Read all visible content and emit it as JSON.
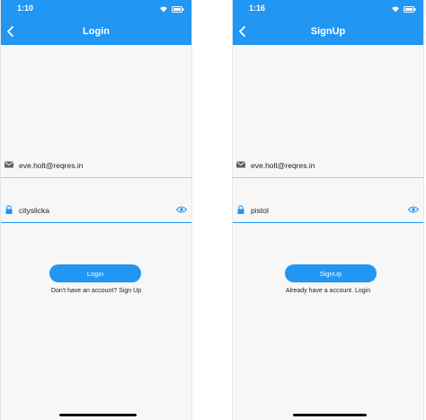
{
  "colors": {
    "primary": "#2196f3",
    "background": "#f7f7f7",
    "underline": "#c8c8c8",
    "icon": "#616161"
  },
  "login_screen": {
    "status_time": "1:10",
    "title": "Login",
    "email_value": "eve.holt@reqres.in",
    "password_value": "cityslicka",
    "button_label": "Login",
    "switch_text": "Don't have an account? Sign Up"
  },
  "signup_screen": {
    "status_time": "1:16",
    "title": "SignUp",
    "email_value": "eve.holt@reqres.in",
    "password_value": "pistol",
    "button_label": "SignUp",
    "switch_text": "Already have a account. Login"
  },
  "icons": [
    "back-arrow-icon",
    "mail-icon",
    "lock-icon",
    "eye-icon",
    "wifi-icon",
    "battery-icon"
  ]
}
